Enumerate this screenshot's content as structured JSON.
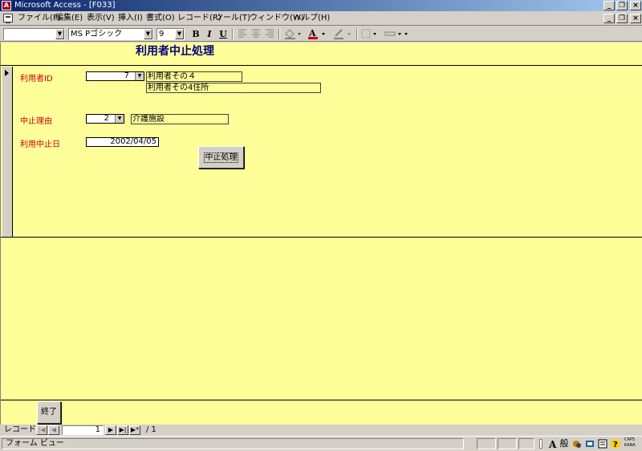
{
  "titlebar": {
    "icon_text": "A",
    "title": "Microsoft Access - [F033]"
  },
  "window_controls": {
    "minimize": "_",
    "restore": "❐",
    "close": "×"
  },
  "menu": [
    "ファイル(F)",
    "編集(E)",
    "表示(V)",
    "挿入(I)",
    "書式(O)",
    "レコード(R)",
    "ツール(T)",
    "ウィンドウ(W)",
    "ヘルプ(H)"
  ],
  "toolbar": {
    "object_combo": "",
    "font_name": "MS Pゴシック",
    "font_size": "9",
    "bold": "B",
    "italic": "I",
    "underline": "U",
    "dropdown_arrow": "▼"
  },
  "form": {
    "title": "利用者中止処理",
    "user_id_label": "利用者ID",
    "user_id_value": "7",
    "user_name": "利用者その４",
    "user_address": "利用者その4住所",
    "reason_label": "中止理由",
    "reason_value": "2",
    "reason_text": "介護施設",
    "stop_date_label": "利用中止日",
    "stop_date_value": "2002/04/05",
    "process_button": "中止処理",
    "close_button": "終了"
  },
  "record_nav": {
    "label": "レコード:",
    "current": "1",
    "total": "/ 1",
    "first": "|◀",
    "prev": "◀",
    "next": "▶",
    "last": "▶|",
    "new": "▶*"
  },
  "status": {
    "text": "フォーム ビュー",
    "caps": "CAPS",
    "kana": "KANA",
    "ime_mode": "般"
  }
}
